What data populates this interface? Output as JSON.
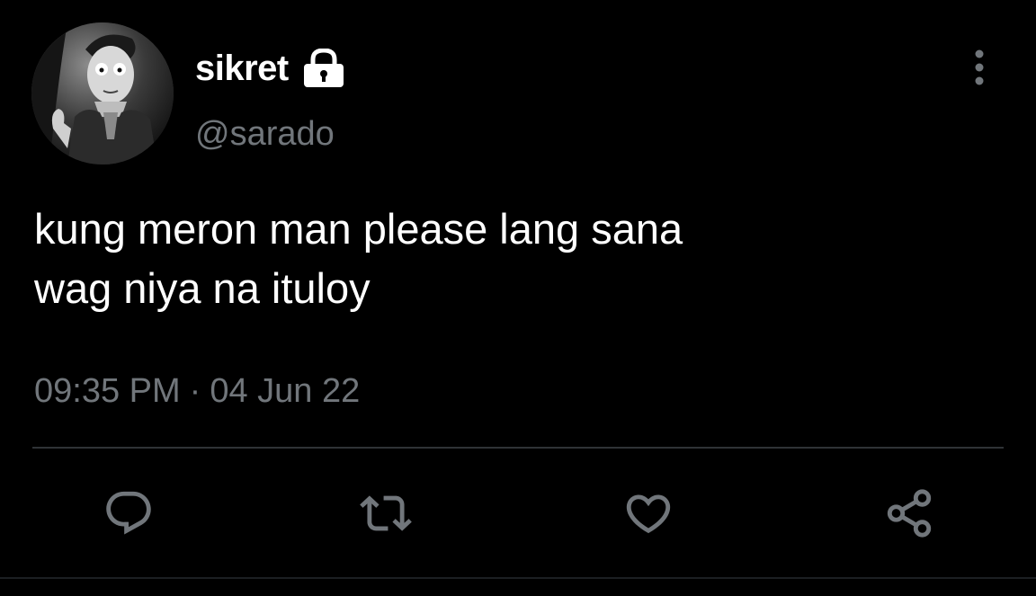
{
  "user": {
    "display_name": "sikret",
    "handle": "@sarado",
    "avatar_icon": "avatar",
    "protected_icon": "lock-icon"
  },
  "tweet": {
    "text": "kung meron man please lang sana\nwag niya na ituloy",
    "time": "09:35 PM",
    "separator": "·",
    "date": "04 Jun 22"
  },
  "actions": [
    {
      "name": "reply",
      "icon": "reply-icon"
    },
    {
      "name": "retweet",
      "icon": "retweet-icon"
    },
    {
      "name": "like",
      "icon": "heart-icon"
    },
    {
      "name": "share",
      "icon": "share-icon"
    }
  ],
  "menu_icon": "more-vertical-icon",
  "colors": {
    "background": "#000000",
    "primary_text": "#ffffff",
    "secondary_text": "#71767b",
    "icon": "#71767b",
    "divider": "#2f3336"
  }
}
